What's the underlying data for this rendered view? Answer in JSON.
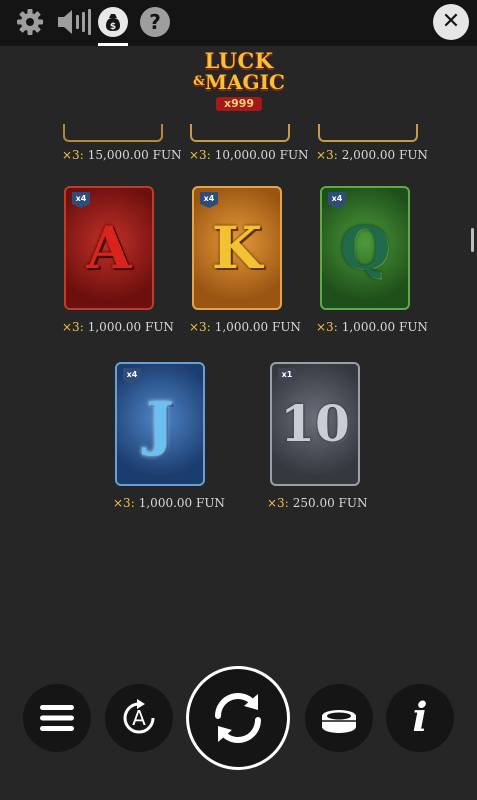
{
  "topbar": {
    "icons": [
      "gear-icon",
      "sound-icon",
      "bet-icon",
      "help-icon",
      "close-icon"
    ],
    "help_label": "?",
    "close_label": "✕"
  },
  "logo": {
    "line1": "LUCK",
    "amp": "&",
    "line2": "MAGIC",
    "badge": "x999"
  },
  "paytable": {
    "top_row": [
      {
        "count": "×3:",
        "payout": "15,000.00 FUN"
      },
      {
        "count": "×3:",
        "payout": "10,000.00 FUN"
      },
      {
        "count": "×3:",
        "payout": "2,000.00 FUN"
      }
    ],
    "cards": [
      {
        "symbol": "A",
        "multiplier": "x4",
        "count": "×3:",
        "payout": "1,000.00 FUN"
      },
      {
        "symbol": "K",
        "multiplier": "x4",
        "count": "×3:",
        "payout": "1,000.00 FUN"
      },
      {
        "symbol": "Q",
        "multiplier": "x4",
        "count": "×3:",
        "payout": "1,000.00 FUN"
      },
      {
        "symbol": "J",
        "multiplier": "x4",
        "count": "×3:",
        "payout": "1,000.00 FUN"
      },
      {
        "symbol": "10",
        "multiplier": "x1",
        "count": "×3:",
        "payout": "250.00 FUN"
      }
    ]
  },
  "controls": {
    "menu_icon": "menu-icon",
    "autoplay_label": "A",
    "spin_icon": "spin-icon",
    "coins_icon": "coins-icon",
    "info_label": "i"
  },
  "colors": {
    "background": "#262626",
    "topbar": "#141414",
    "gold": "#f2c24c"
  }
}
